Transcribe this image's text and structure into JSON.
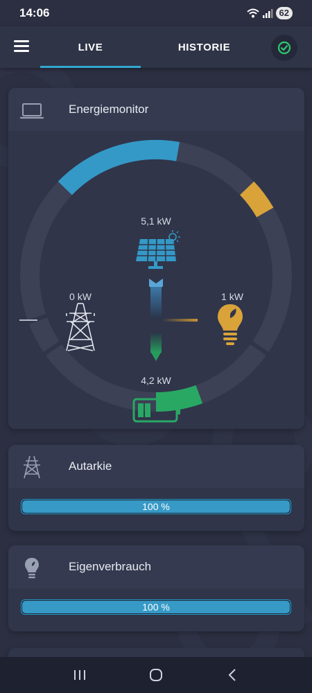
{
  "status_bar": {
    "time": "14:06",
    "battery": "62",
    "icons": [
      "wifi-icon",
      "signal-icon"
    ]
  },
  "app_bar": {
    "menu_icon": "menu-icon",
    "tabs": [
      {
        "label": "LIVE",
        "active": true
      },
      {
        "label": "HISTORIE",
        "active": false
      }
    ],
    "status_icon": "check-circle-icon"
  },
  "monitor": {
    "title": "Energiemonitor",
    "icon": "laptop-icon",
    "solar_value": "5,1 kW",
    "grid_value": "0 kW",
    "consumption_value": "1 kW",
    "battery_value": "4,2 kW",
    "colors": {
      "solar": "#3499c7",
      "consumption": "#d9a33a",
      "battery": "#29a864",
      "grid": "#e6e8ef"
    }
  },
  "autarkie": {
    "title": "Autarkie",
    "icon": "power-pylon-icon",
    "progress_label": "100 %",
    "progress": 1.0
  },
  "eigenverbrauch": {
    "title": "Eigenverbrauch",
    "icon": "lightbulb-icon",
    "progress_label": "100 %",
    "progress": 1.0
  },
  "nav_bar": {
    "items": [
      "recent-apps-icon",
      "home-icon",
      "back-icon"
    ]
  }
}
